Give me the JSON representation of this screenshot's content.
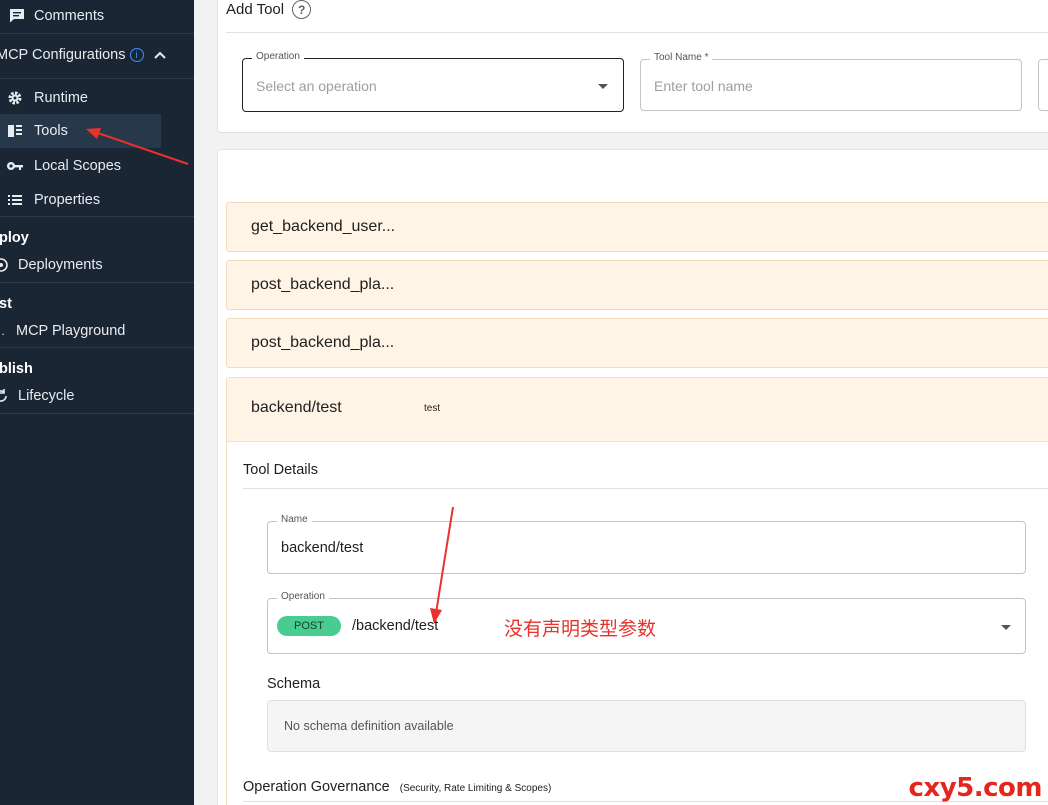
{
  "sidebar": {
    "items": [
      {
        "icon": "comment-icon",
        "label": "Comments"
      },
      {
        "icon": "info-icon",
        "label": "MCP Configurations"
      },
      {
        "icon": "gear-icon",
        "label": "Runtime"
      },
      {
        "icon": "tools-icon",
        "label": "Tools"
      },
      {
        "icon": "key-icon",
        "label": "Local Scopes"
      },
      {
        "icon": "list-icon",
        "label": "Properties"
      }
    ],
    "deploy_section": "ploy",
    "deployments": "Deployments",
    "test_section": "st",
    "playground": "MCP Playground",
    "publish_section": "blish",
    "lifecycle": "Lifecycle"
  },
  "add_tool": {
    "title": "Add Tool",
    "help_glyph": "?",
    "operation_label": "Operation",
    "operation_placeholder": "Select an operation",
    "tool_name_label": "Tool Name *",
    "tool_name_placeholder": "Enter tool name"
  },
  "tools": [
    {
      "name": "get_backend_user..."
    },
    {
      "name": "post_backend_pla..."
    },
    {
      "name": "post_backend_pla..."
    }
  ],
  "expanded_tool": {
    "name": "backend/test",
    "description": "test",
    "details_title": "Tool Details",
    "name_label": "Name",
    "name_value": "backend/test",
    "operation_label": "Operation",
    "method": "POST",
    "path": "/backend/test",
    "schema_title": "Schema",
    "schema_empty": "No schema definition available",
    "governance_title": "Operation Governance",
    "governance_subtitle": "(Security, Rate Limiting & Scopes)"
  },
  "annotation_text": "没有声明类型参数",
  "watermark": "cxy5.com",
  "colors": {
    "sidebar_bg": "#1b2634",
    "tool_row_bg": "#fff4e5",
    "post_badge": "#49cc90",
    "annotation": "#e8322b"
  }
}
